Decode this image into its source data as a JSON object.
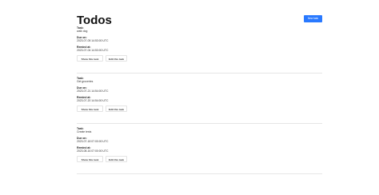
{
  "page": {
    "title": "Todos",
    "new_task_label": "New task"
  },
  "labels": {
    "task": "Task:",
    "due_on": "Due on:",
    "remind_at": "Remind at:",
    "show_button": "Show this task",
    "edit_button": "Edit this task"
  },
  "tasks": [
    {
      "name": "walk dog",
      "due_on": "2023-07-05 14:53:00 UTC",
      "remind_at": "2023-07-04 14:53:00 UTC"
    },
    {
      "name": "Get groceries",
      "due_on": "2023-07-21 14:54:00 UTC",
      "remind_at": "2023-07-20 14:54:00 UTC"
    },
    {
      "name": "Create tests",
      "due_on": "2023-07-18 07:00:00 UTC",
      "remind_at": "2023-08-16 07:00:00 UTC"
    }
  ],
  "colors": {
    "accent": "#2979ff",
    "divider": "#e6e6e6"
  }
}
